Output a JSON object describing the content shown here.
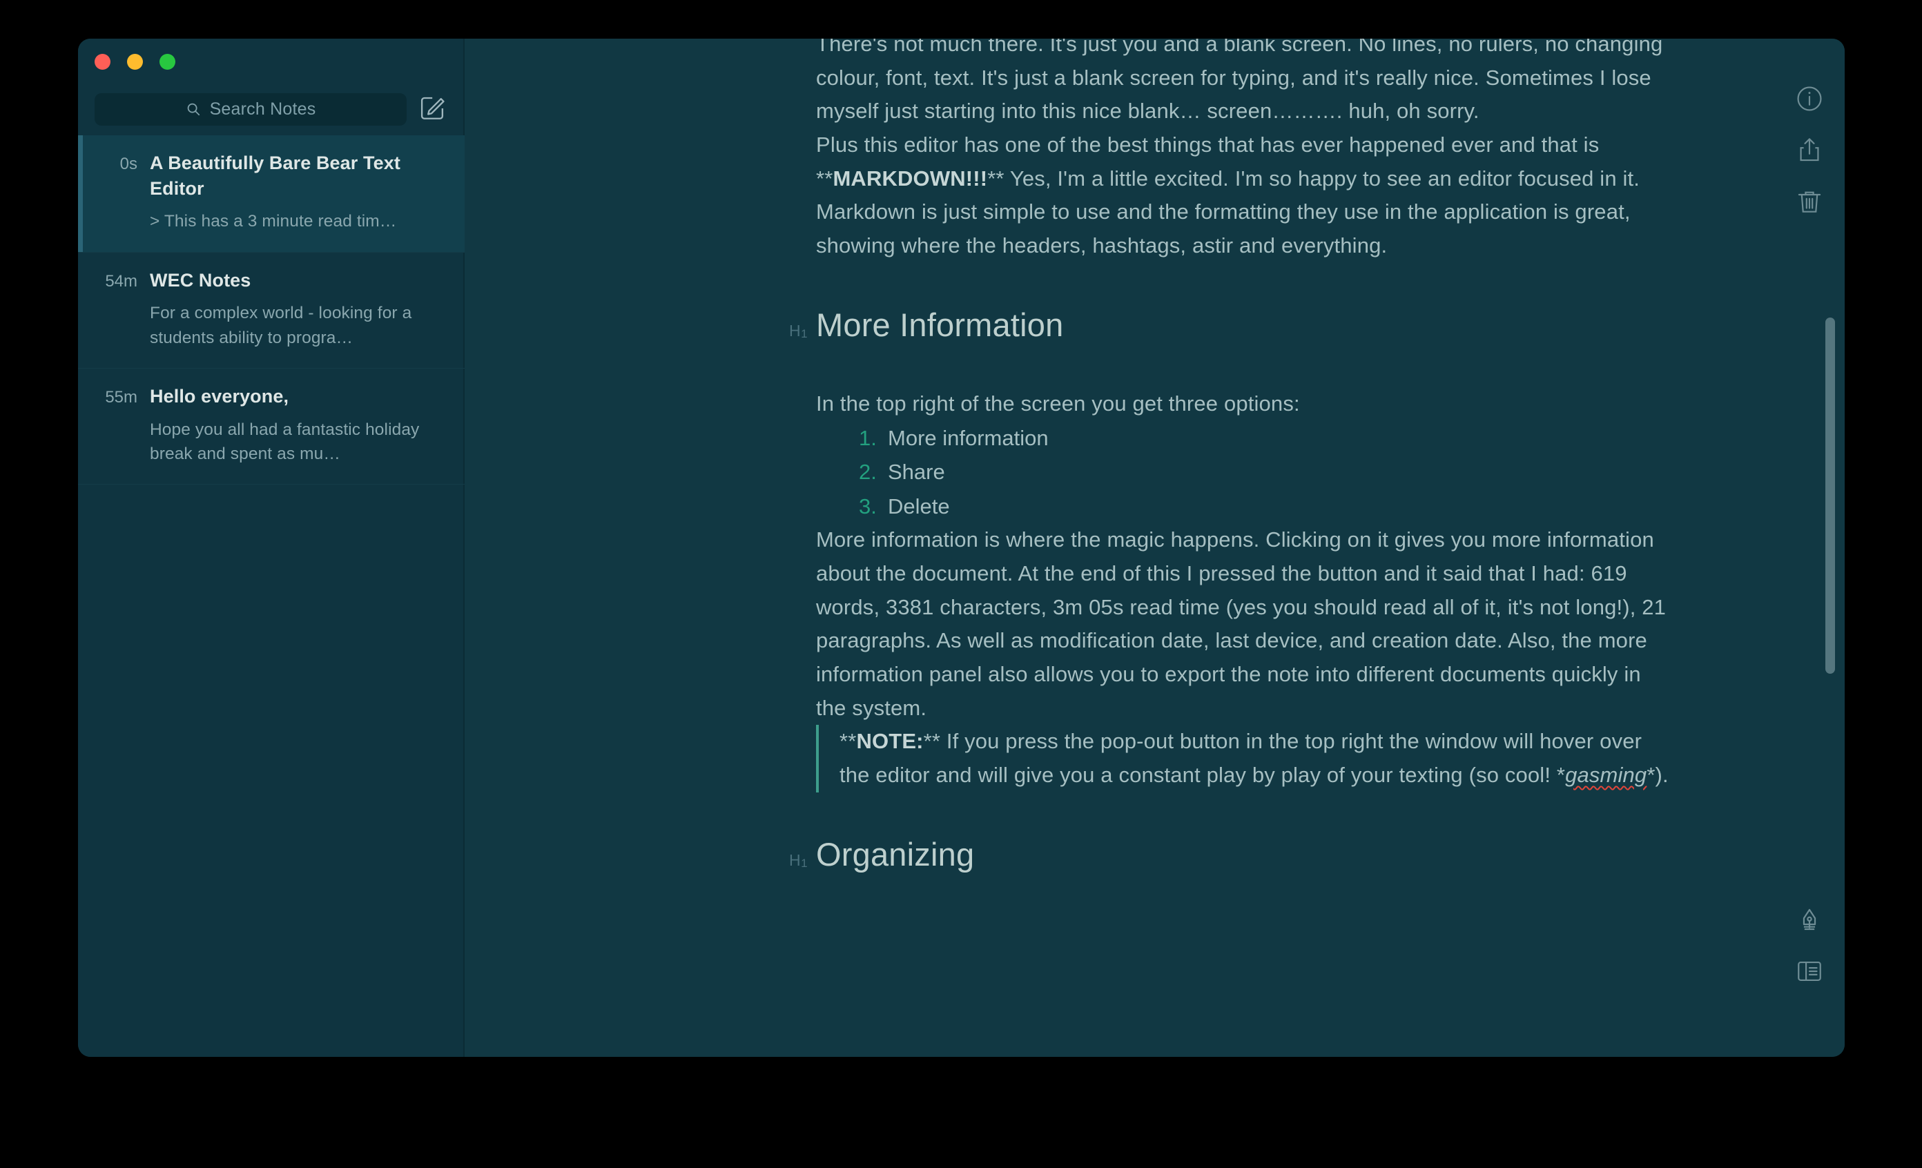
{
  "window": {
    "traffic_lights": {
      "close_color": "#ff5f57",
      "minimize_color": "#febc2e",
      "maximize_color": "#28c840"
    },
    "background_color": "#113843",
    "sidebar_color": "#0f3440"
  },
  "sidebar": {
    "search": {
      "placeholder": "Search Notes",
      "icon": "search-icon"
    },
    "compose": {
      "icon": "compose-note-icon",
      "label": "New Note"
    },
    "notes": [
      {
        "time": "0s",
        "title": "A Beautifully Bare Bear Text Editor",
        "snippet": "> This has a 3 minute read tim…",
        "selected": true
      },
      {
        "time": "54m",
        "title": "WEC Notes",
        "snippet": "For a complex world - looking for a students ability to progra…",
        "selected": false
      },
      {
        "time": "55m",
        "title": "Hello everyone,",
        "snippet": "Hope you all had a fantastic holiday break and spent as mu…",
        "selected": false
      }
    ]
  },
  "toolbar": {
    "info_label": "More information",
    "share_label": "Share",
    "trash_label": "Delete",
    "pen_label": "Theme",
    "layout_label": "Toggle sidebar"
  },
  "editor": {
    "accent_color": "#23a07f",
    "quote_border_color": "#3d9e8c",
    "text_color": "#a6bfc2",
    "heading_color": "#bed0ce",
    "blocks": [
      {
        "type": "paragraph",
        "name": "paragraph-blank-screen",
        "text": "There's not much there. It's just you and a blank screen. No lines, no rulers, no changing colour, font, text. It's just a blank screen for typing, and it's really nice. Sometimes I lose myself just starting into this nice blank… screen………. huh, oh sorry."
      },
      {
        "type": "paragraph",
        "name": "paragraph-markdown",
        "pre": "Plus this editor has one of the best things that has ever happened ever and that is **",
        "bold": "MARKDOWN!!!",
        "post": "** Yes, I'm a little excited. I'm so happy to see an editor focused in it. Markdown is just simple to use and the formatting they use in the application is great, showing where the headers, hashtags, astir and everything."
      },
      {
        "type": "heading",
        "level": "H1",
        "name": "heading-more-information",
        "text": "More Information",
        "marker": "H",
        "marker_sub": "1"
      },
      {
        "type": "paragraph",
        "name": "paragraph-three-options",
        "text": "In the top right of the screen you get three options:"
      },
      {
        "type": "ordered-list",
        "name": "list-top-right-options",
        "items": [
          "More information",
          "Share",
          "Delete"
        ]
      },
      {
        "type": "paragraph",
        "name": "paragraph-magic-happens",
        "text": "More information is where the magic happens. Clicking on it gives you more information about the document. At the end of this I pressed the button and it said that I had: 619 words,  3381 characters, 3m 05s read time (yes you should read all of it, it's not long!), 21 paragraphs. As well as modification date, last device, and creation date. Also, the more information panel also allows you to export the note into different documents quickly in the system."
      },
      {
        "type": "blockquote",
        "name": "blockquote-note",
        "pre": "**",
        "bold": "NOTE:",
        "mid": "** If you press the pop-out button in the top right the window will hover over the editor and will give you a constant play by play of your texting (so cool! *",
        "italic_misspelled": "gasming",
        "post": "*)."
      },
      {
        "type": "heading",
        "level": "H1",
        "name": "heading-organizing",
        "text": "Organizing",
        "marker": "H",
        "marker_sub": "1"
      }
    ]
  },
  "stats_mentioned": {
    "words": 619,
    "characters": 3381,
    "read_time": "3m 05s",
    "paragraphs": 21
  }
}
